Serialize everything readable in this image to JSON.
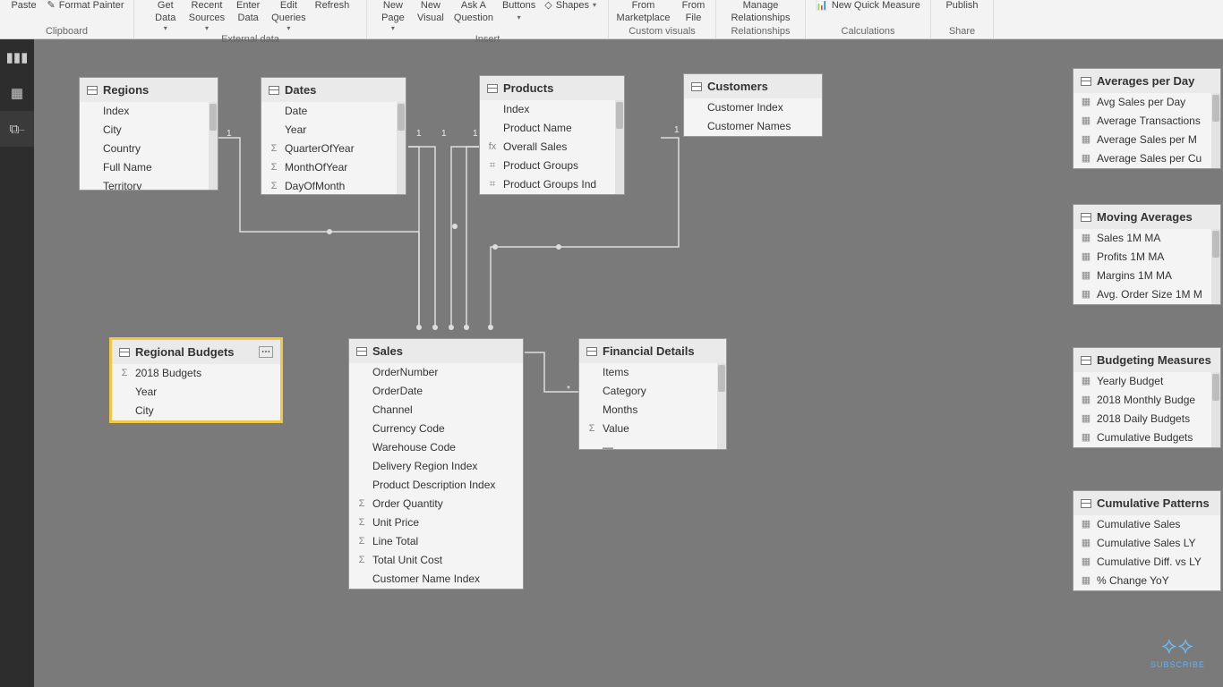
{
  "ribbon": {
    "groups": [
      {
        "label": "Clipboard",
        "items": [
          "Paste",
          "Format Painter"
        ]
      },
      {
        "label": "External data",
        "items": [
          "Get Data",
          "Recent Sources",
          "Enter Data",
          "Edit Queries",
          "Refresh"
        ]
      },
      {
        "label": "Insert",
        "items": [
          "New Page",
          "New Visual",
          "Ask A Question",
          "Buttons",
          "Shapes"
        ]
      },
      {
        "label": "Custom visuals",
        "items": [
          "From Marketplace",
          "From File"
        ]
      },
      {
        "label": "Relationships",
        "items": [
          "Manage Relationships"
        ]
      },
      {
        "label": "Calculations",
        "items": [
          "New Quick Measure"
        ]
      },
      {
        "label": "Share",
        "items": [
          "Publish"
        ]
      }
    ]
  },
  "tables": {
    "regions": {
      "title": "Regions",
      "fields": [
        {
          "n": "Index"
        },
        {
          "n": "City"
        },
        {
          "n": "Country"
        },
        {
          "n": "Full Name"
        },
        {
          "n": "Territory"
        }
      ]
    },
    "dates": {
      "title": "Dates",
      "fields": [
        {
          "n": "Date"
        },
        {
          "n": "Year"
        },
        {
          "n": "QuarterOfYear",
          "i": "Σ"
        },
        {
          "n": "MonthOfYear",
          "i": "Σ"
        },
        {
          "n": "DayOfMonth",
          "i": "Σ"
        }
      ]
    },
    "products": {
      "title": "Products",
      "fields": [
        {
          "n": "Index"
        },
        {
          "n": "Product Name"
        },
        {
          "n": "Overall Sales",
          "i": "fx"
        },
        {
          "n": "Product Groups",
          "i": "⌗"
        },
        {
          "n": "Product Groups Ind",
          "i": "⌗"
        }
      ]
    },
    "customers": {
      "title": "Customers",
      "fields": [
        {
          "n": "Customer Index"
        },
        {
          "n": "Customer Names"
        }
      ]
    },
    "regbud": {
      "title": "Regional Budgets",
      "fields": [
        {
          "n": "2018 Budgets",
          "i": "Σ"
        },
        {
          "n": "Year"
        },
        {
          "n": "City"
        }
      ]
    },
    "sales": {
      "title": "Sales",
      "fields": [
        {
          "n": "OrderNumber"
        },
        {
          "n": "OrderDate"
        },
        {
          "n": "Channel"
        },
        {
          "n": "Currency Code"
        },
        {
          "n": "Warehouse Code"
        },
        {
          "n": "Delivery Region Index"
        },
        {
          "n": "Product Description Index"
        },
        {
          "n": "Order Quantity",
          "i": "Σ"
        },
        {
          "n": "Unit Price",
          "i": "Σ"
        },
        {
          "n": "Line Total",
          "i": "Σ"
        },
        {
          "n": "Total Unit Cost",
          "i": "Σ"
        },
        {
          "n": "Customer Name Index"
        }
      ]
    },
    "fin": {
      "title": "Financial Details",
      "fields": [
        {
          "n": "Items"
        },
        {
          "n": "Category"
        },
        {
          "n": "Months"
        },
        {
          "n": "Value",
          "i": "Σ"
        },
        {
          "n": "—"
        }
      ]
    },
    "avgday": {
      "title": "Averages per Day",
      "fields": [
        {
          "n": "Avg Sales per Day",
          "i": "▦"
        },
        {
          "n": "Average Transactions",
          "i": "▦"
        },
        {
          "n": "Average Sales per M",
          "i": "▦"
        },
        {
          "n": "Average Sales per Cu",
          "i": "▦"
        }
      ]
    },
    "movavg": {
      "title": "Moving Averages",
      "fields": [
        {
          "n": "Sales 1M MA",
          "i": "▦"
        },
        {
          "n": "Profits 1M MA",
          "i": "▦"
        },
        {
          "n": "Margins 1M MA",
          "i": "▦"
        },
        {
          "n": "Avg. Order Size 1M M",
          "i": "▦"
        }
      ]
    },
    "budmeas": {
      "title": "Budgeting Measures",
      "fields": [
        {
          "n": "Yearly Budget",
          "i": "▦"
        },
        {
          "n": "2018 Monthly Budge",
          "i": "▦"
        },
        {
          "n": "2018 Daily Budgets",
          "i": "▦"
        },
        {
          "n": "Cumulative Budgets",
          "i": "▦"
        }
      ]
    },
    "cumpat": {
      "title": "Cumulative Patterns",
      "fields": [
        {
          "n": "Cumulative Sales",
          "i": "▦"
        },
        {
          "n": "Cumulative Sales LY",
          "i": "▦"
        },
        {
          "n": "Cumulative Diff. vs LY",
          "i": "▦"
        },
        {
          "n": "% Change YoY",
          "i": "▦"
        }
      ]
    }
  },
  "cardinality": {
    "one": "1",
    "many": "*"
  },
  "watermark": "SUBSCRIBE"
}
